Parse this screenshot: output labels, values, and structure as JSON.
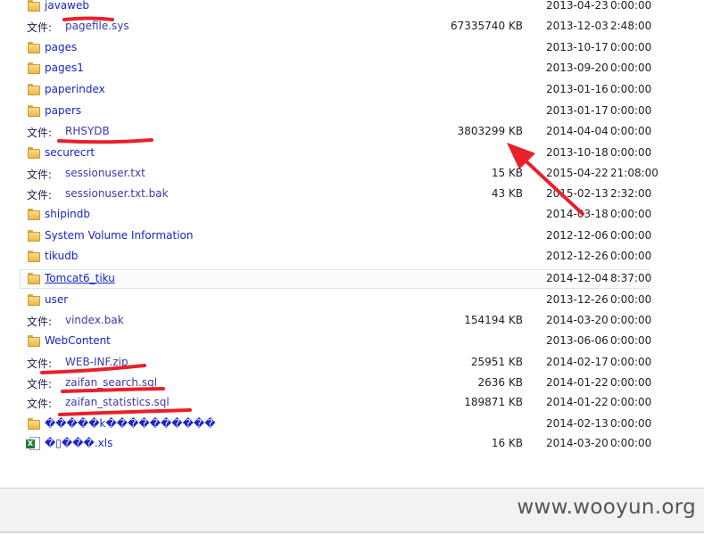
{
  "file_prefix": "文件:",
  "rows": [
    {
      "type": "folder",
      "name": "javaweb",
      "size": "",
      "date": "2013-04-23",
      "time": "0:00:00"
    },
    {
      "type": "file",
      "name": "pagefile.sys",
      "size": "67335740 KB",
      "date": "2013-12-03",
      "time": "2:48:00"
    },
    {
      "type": "folder",
      "name": "pages",
      "size": "",
      "date": "2013-10-17",
      "time": "0:00:00"
    },
    {
      "type": "folder",
      "name": "pages1",
      "size": "",
      "date": "2013-09-20",
      "time": "0:00:00"
    },
    {
      "type": "folder",
      "name": "paperindex",
      "size": "",
      "date": "2013-01-16",
      "time": "0:00:00"
    },
    {
      "type": "folder",
      "name": "papers",
      "size": "",
      "date": "2013-01-17",
      "time": "0:00:00"
    },
    {
      "type": "file",
      "name": "RHSYDB",
      "size": "3803299 KB",
      "date": "2014-04-04",
      "time": "0:00:00"
    },
    {
      "type": "folder",
      "name": "securecrt",
      "size": "",
      "date": "2013-10-18",
      "time": "0:00:00"
    },
    {
      "type": "file",
      "name": "sessionuser.txt",
      "size": "15 KB",
      "date": "2015-04-22",
      "time": "21:08:00"
    },
    {
      "type": "file",
      "name": "sessionuser.txt.bak",
      "size": "43 KB",
      "date": "2015-02-13",
      "time": "2:32:00"
    },
    {
      "type": "folder",
      "name": "shipindb",
      "size": "",
      "date": "2014-03-18",
      "time": "0:00:00"
    },
    {
      "type": "folder",
      "name": "System Volume Information",
      "size": "",
      "date": "2012-12-06",
      "time": "0:00:00"
    },
    {
      "type": "folder",
      "name": "tikudb",
      "size": "",
      "date": "2012-12-26",
      "time": "0:00:00"
    },
    {
      "type": "folder",
      "name": "Tomcat6_tiku",
      "size": "",
      "date": "2014-12-04",
      "time": "8:37:00",
      "hover": true
    },
    {
      "type": "folder",
      "name": "user",
      "size": "",
      "date": "2013-12-26",
      "time": "0:00:00"
    },
    {
      "type": "file",
      "name": "vindex.bak",
      "size": "154194 KB",
      "date": "2014-03-20",
      "time": "0:00:00"
    },
    {
      "type": "folder",
      "name": "WebContent",
      "size": "",
      "date": "2013-06-06",
      "time": "0:00:00"
    },
    {
      "type": "file",
      "name": "WEB-INF.zip",
      "size": "25951 KB",
      "date": "2014-02-17",
      "time": "0:00:00"
    },
    {
      "type": "file",
      "name": "zaifan_search.sql",
      "size": "2636 KB",
      "date": "2014-01-22",
      "time": "0:00:00"
    },
    {
      "type": "file",
      "name": "zaifan_statistics.sql",
      "size": "189871 KB",
      "date": "2014-01-22",
      "time": "0:00:00"
    },
    {
      "type": "folder",
      "name": "�����k����������",
      "size": "",
      "date": "2014-02-13",
      "time": "0:00:00"
    },
    {
      "type": "xls",
      "name": "�▯���.xls",
      "size": "16 KB",
      "date": "2014-03-20",
      "time": "0:00:00"
    }
  ],
  "footer": {
    "watermark": "www.wooyun.org"
  },
  "colors": {
    "annotation": "#e8202a",
    "link": "#1a24c8",
    "footer_bg": "#f2f2f2"
  },
  "icons": {
    "folder": "folder-icon",
    "excel": "excel-file-icon"
  }
}
